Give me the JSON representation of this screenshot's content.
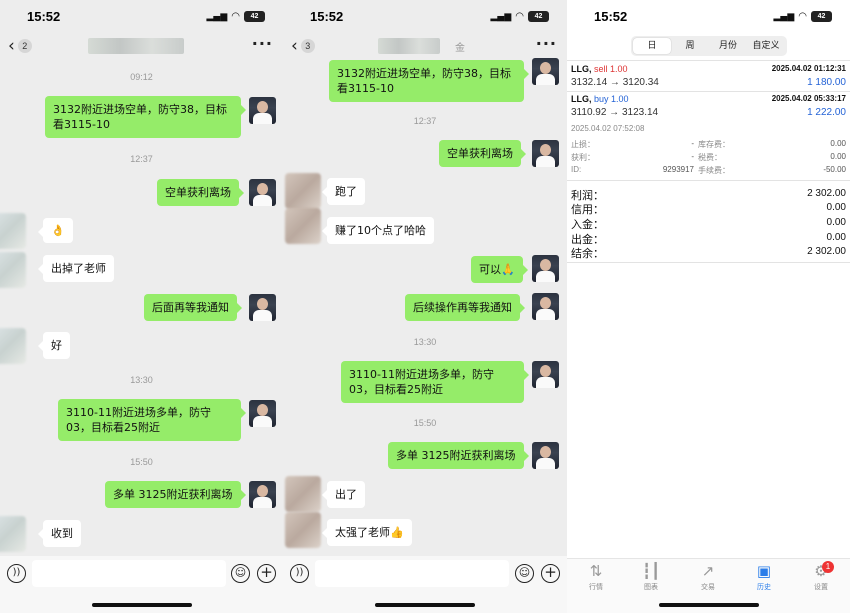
{
  "status": {
    "time": "15:52",
    "battery": "42"
  },
  "panel1": {
    "unread": "2",
    "timestamps": [
      "09:12",
      "12:37",
      "13:30",
      "15:50"
    ],
    "messages": [
      "3132附近进场空单，防守38，目标看3115-10",
      "空单获利离场",
      "👌",
      "出掉了老师",
      "后面再等我通知",
      "好",
      "3110-11附近进场多单，防守03，目标看25附近",
      "多单 3125附近获利离场",
      "收到"
    ]
  },
  "panel2": {
    "unread": "3",
    "title_suffix": "金",
    "timestamps": [
      "12:37",
      "13:30",
      "15:50"
    ],
    "messages": [
      "3132附近进场空单，防守38，目标看3115-10",
      "空单获利离场",
      "跑了",
      "赚了10个点了哈哈",
      "可以🙏",
      "后续操作再等我通知",
      "3110-11附近进场多单，防守03，目标看25附近",
      "多单 3125附近获利离场",
      "出了",
      "太强了老师👍"
    ]
  },
  "panel3": {
    "segments": [
      "日",
      "周",
      "月份",
      "自定义"
    ],
    "trades": [
      {
        "symbol": "LLG,",
        "action": "sell 1.00",
        "datetime": "2025.04.02 01:12:31",
        "prices": "3132.14 → 3120.34",
        "profit": "1 180.00"
      },
      {
        "symbol": "LLG,",
        "action": "buy 1.00",
        "datetime": "2025.04.02 05:33:17",
        "prices": "3110.92 → 3123.14",
        "profit": "1 222.00"
      }
    ],
    "detail": {
      "open_time": "2025.04.02 07:52:08",
      "sl_label": "止损：",
      "sl_value": "-",
      "tp_label": "获利：",
      "tp_value": "-",
      "id_label": "ID:",
      "id_value": "9293917",
      "swap_label": "库存费：",
      "swap_value": "0.00",
      "tax_label": "税费：",
      "tax_value": "0.00",
      "fee_label": "手续费：",
      "fee_value": "-50.00"
    },
    "summary": [
      {
        "label": "利润：",
        "value": "2 302.00"
      },
      {
        "label": "信用：",
        "value": "0.00"
      },
      {
        "label": "入金：",
        "value": "0.00"
      },
      {
        "label": "出金：",
        "value": "0.00"
      },
      {
        "label": "结余：",
        "value": "2 302.00"
      }
    ],
    "tabs": [
      "行情",
      "图表",
      "交易",
      "历史",
      "设置"
    ],
    "settings_badge": "1"
  }
}
